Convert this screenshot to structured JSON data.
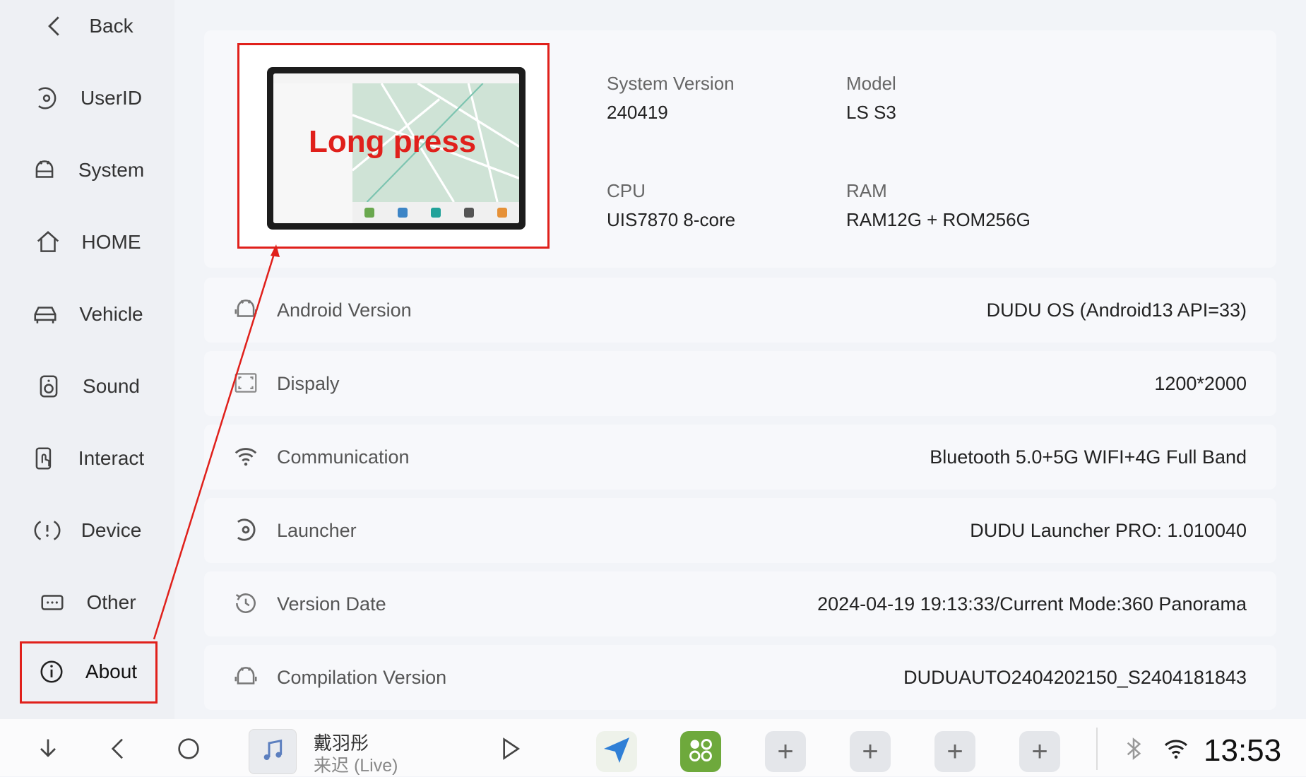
{
  "sidebar": {
    "items": [
      {
        "label": "Back",
        "icon": "chevron-left-icon"
      },
      {
        "label": "UserID",
        "icon": "user-id-icon"
      },
      {
        "label": "System",
        "icon": "android-icon"
      },
      {
        "label": "HOME",
        "icon": "home-icon"
      },
      {
        "label": "Vehicle",
        "icon": "car-icon"
      },
      {
        "label": "Sound",
        "icon": "speaker-icon"
      },
      {
        "label": "Interact",
        "icon": "touch-icon"
      },
      {
        "label": "Device",
        "icon": "device-alert-icon"
      },
      {
        "label": "Other",
        "icon": "more-icon"
      },
      {
        "label": "About",
        "icon": "info-icon"
      }
    ],
    "active": "About"
  },
  "device_image": {
    "annotation": "Long press",
    "highlight_color": "#e0201b"
  },
  "specs": {
    "system_version": {
      "label": "System Version",
      "value": "240419"
    },
    "model": {
      "label": "Model",
      "value": "LS S3"
    },
    "cpu": {
      "label": "CPU",
      "value": "UIS7870 8-core"
    },
    "ram": {
      "label": "RAM",
      "value": "RAM12G + ROM256G"
    }
  },
  "rows": [
    {
      "label": "Android Version",
      "value": "DUDU OS (Android13 API=33)",
      "icon": "android-icon"
    },
    {
      "label": "Dispaly",
      "value": "1200*2000",
      "icon": "fullscreen-icon"
    },
    {
      "label": "Communication",
      "value": "Bluetooth 5.0+5G WIFI+4G Full Band",
      "icon": "wifi-icon"
    },
    {
      "label": "Launcher",
      "value": "DUDU Launcher PRO: 1.010040",
      "icon": "launcher-icon"
    },
    {
      "label": "Version Date",
      "value": "2024-04-19 19:13:33/Current Mode:360 Panorama",
      "icon": "history-icon"
    },
    {
      "label": "Compilation Version",
      "value": "DUDUAUTO2404202150_S2404181843",
      "icon": "android-icon"
    }
  ],
  "bottombar": {
    "music": {
      "artist": "戴羽彤",
      "title": "来迟 (Live)"
    },
    "clock": "13:53",
    "plus_label": "+"
  },
  "colors": {
    "accent_red": "#e0201b",
    "background": "#f2f4f8",
    "card": "#f7f8fb"
  }
}
